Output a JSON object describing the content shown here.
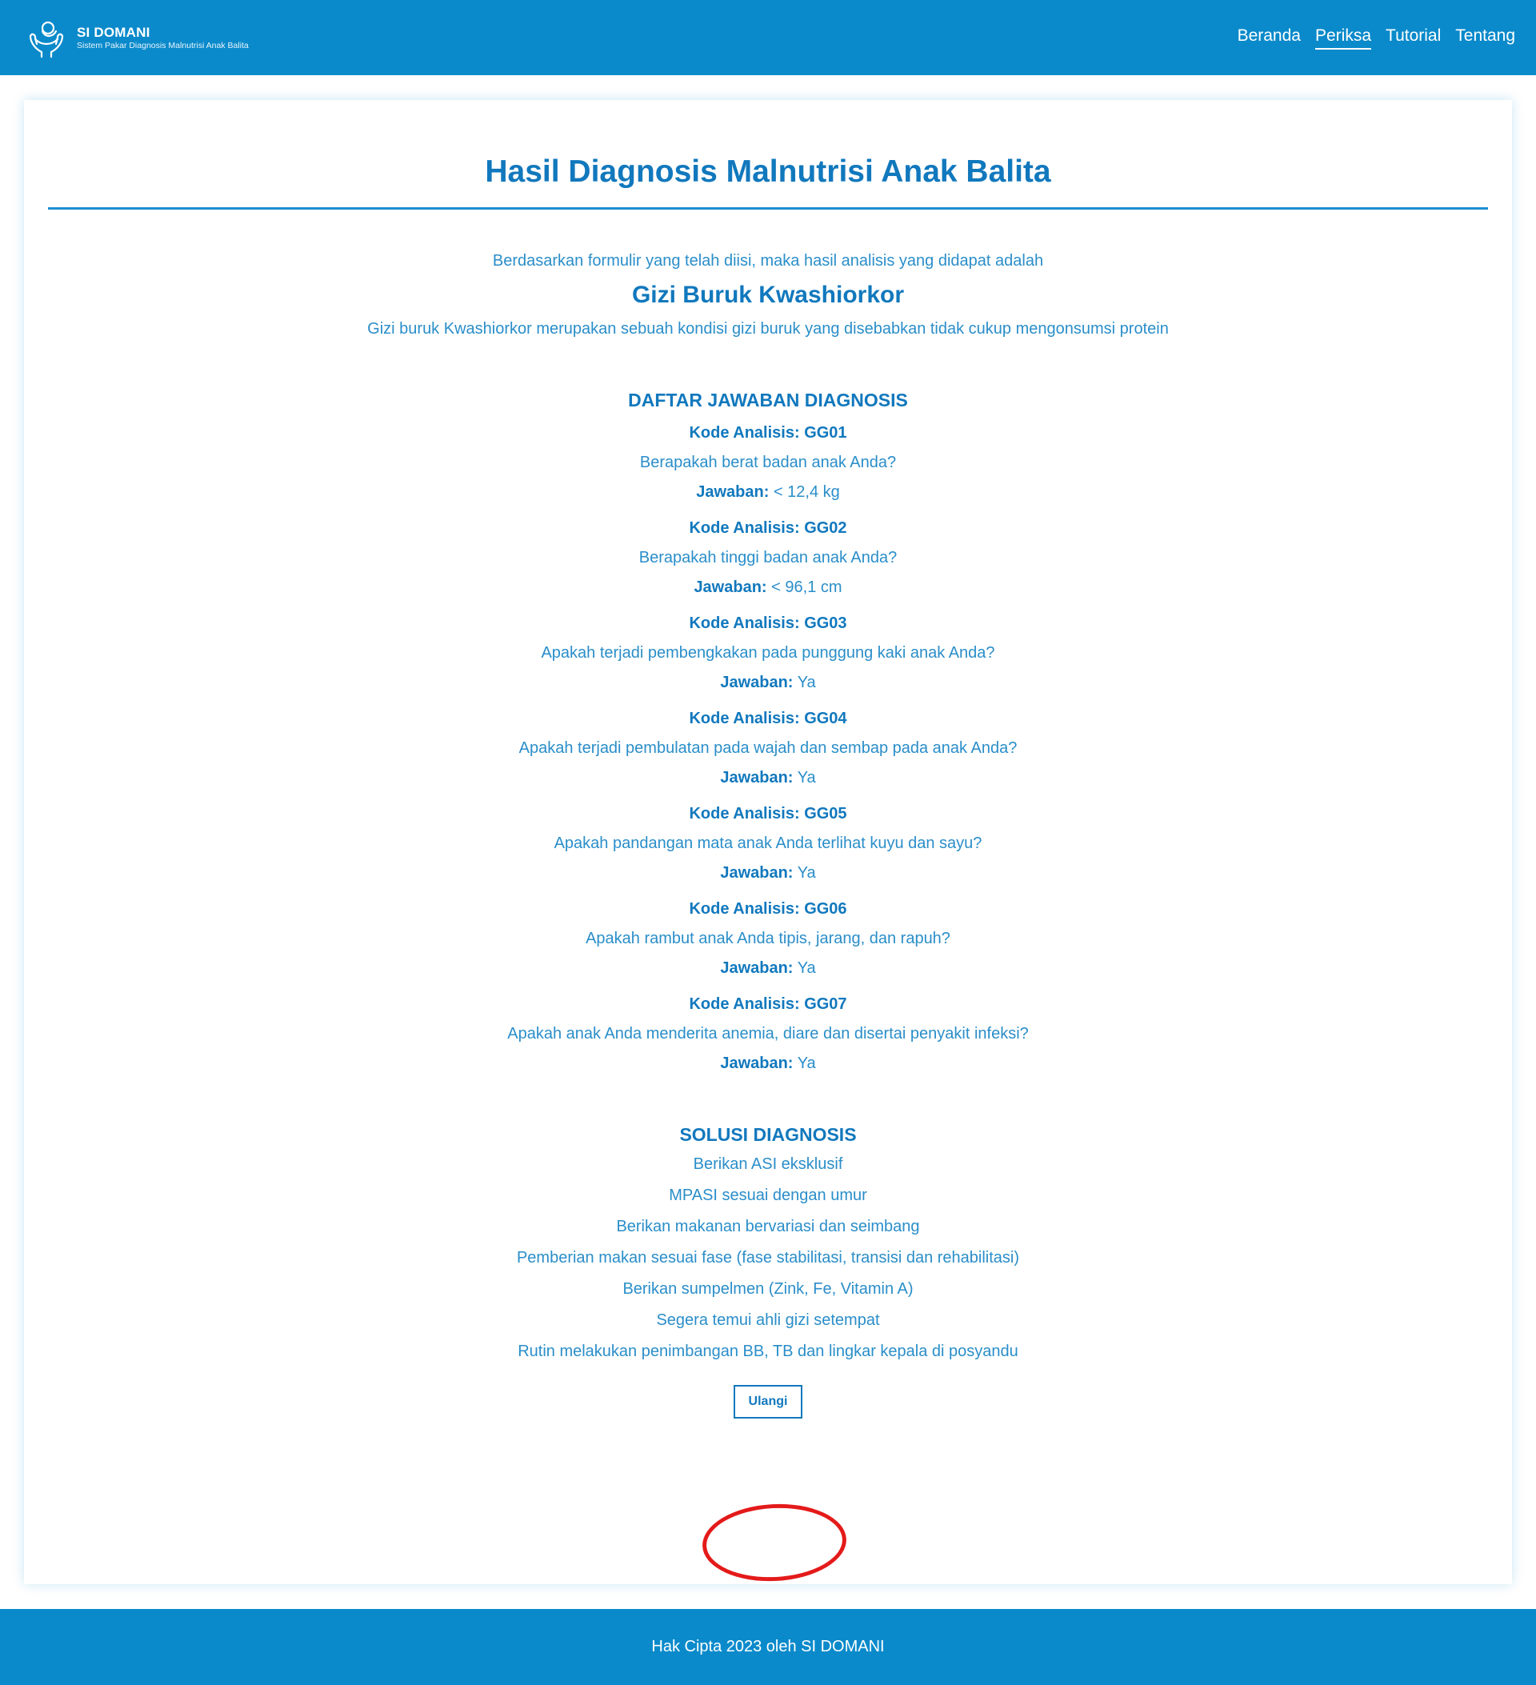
{
  "brand": {
    "title": "SI DOMANI",
    "subtitle": "Sistem Pakar Diagnosis Malnutrisi Anak Balita",
    "logo_icon": "hands-holding-baby-icon"
  },
  "nav": {
    "items": [
      {
        "label": "Beranda",
        "active": false
      },
      {
        "label": "Periksa",
        "active": true
      },
      {
        "label": "Tutorial",
        "active": false
      },
      {
        "label": "Tentang",
        "active": false
      }
    ]
  },
  "page": {
    "title": "Hasil Diagnosis Malnutrisi Anak Balita",
    "intro": "Berdasarkan formulir yang telah diisi, maka hasil analisis yang didapat adalah",
    "result": "Gizi Buruk Kwashiorkor",
    "result_description": "Gizi buruk Kwashiorkor merupakan sebuah kondisi gizi buruk yang disebabkan tidak cukup mengonsumsi protein"
  },
  "answers": {
    "title": "DAFTAR JAWABAN DIAGNOSIS",
    "code_label": "Kode Analisis:",
    "answer_label": "Jawaban:",
    "items": [
      {
        "code": "GG01",
        "question": "Berapakah berat badan anak Anda?",
        "answer": "< 12,4 kg"
      },
      {
        "code": "GG02",
        "question": "Berapakah tinggi badan anak Anda?",
        "answer": "< 96,1 cm"
      },
      {
        "code": "GG03",
        "question": "Apakah terjadi pembengkakan pada punggung kaki anak Anda?",
        "answer": "Ya"
      },
      {
        "code": "GG04",
        "question": "Apakah terjadi pembulatan pada wajah dan sembap pada anak Anda?",
        "answer": "Ya"
      },
      {
        "code": "GG05",
        "question": "Apakah pandangan mata anak Anda terlihat kuyu dan sayu?",
        "answer": "Ya"
      },
      {
        "code": "GG06",
        "question": "Apakah rambut anak Anda tipis, jarang, dan rapuh?",
        "answer": "Ya"
      },
      {
        "code": "GG07",
        "question": "Apakah anak Anda menderita anemia, diare dan disertai penyakit infeksi?",
        "answer": "Ya"
      }
    ]
  },
  "solutions": {
    "title": "SOLUSI DIAGNOSIS",
    "items": [
      "Berikan ASI eksklusif",
      "MPASI sesuai dengan umur",
      "Berikan makanan bervariasi dan seimbang",
      "Pemberian makan sesuai fase (fase stabilitasi, transisi dan rehabilitasi)",
      "Berikan sumpelmen (Zink, Fe, Vitamin A)",
      "Segera temui ahli gizi setempat",
      "Rutin melakukan penimbangan BB, TB dan lingkar kepala di posyandu"
    ]
  },
  "actions": {
    "retry_label": "Ulangi"
  },
  "footer": {
    "text": "Hak Cipta 2023 oleh SI DOMANI"
  },
  "colors": {
    "primary": "#0a8acb",
    "heading": "#1178bd",
    "text": "#2a8ec9",
    "annotation": "#e41a1a"
  }
}
